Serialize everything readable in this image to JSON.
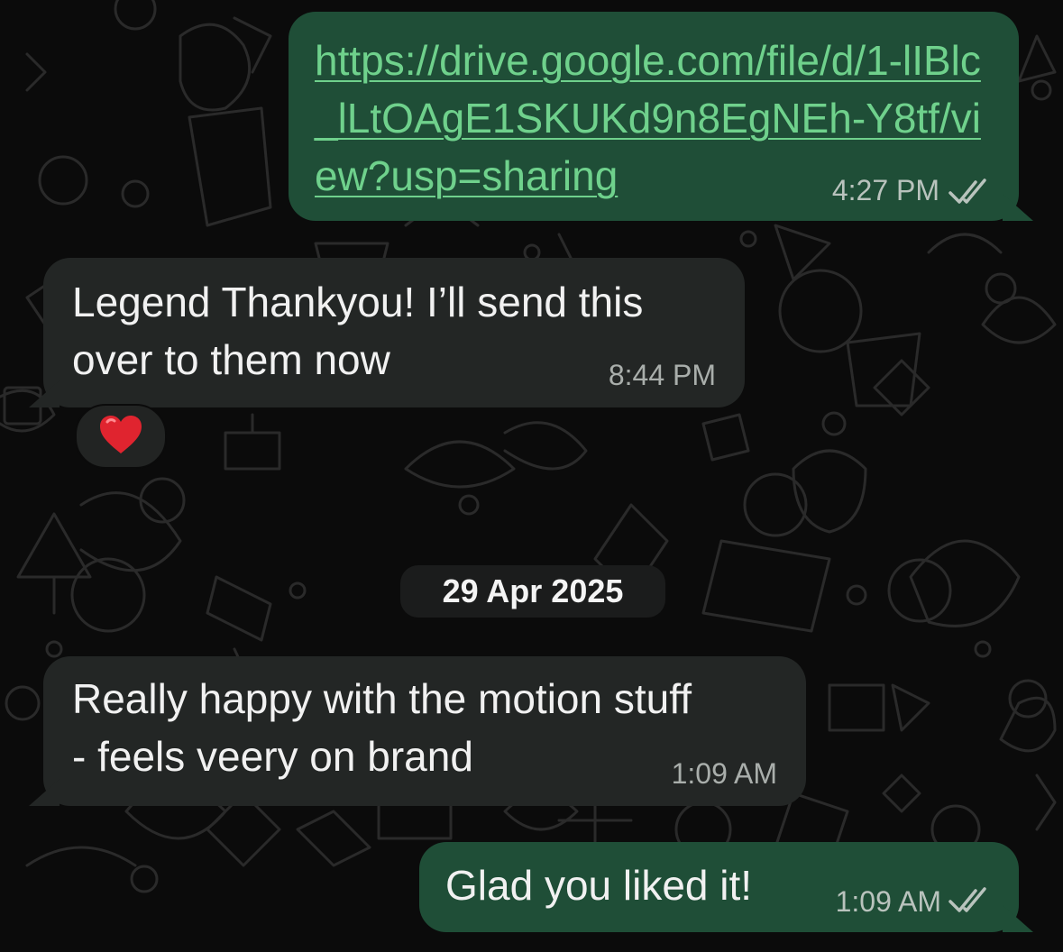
{
  "chat": {
    "date_divider": "29 Apr 2025",
    "messages": [
      {
        "direction": "outgoing",
        "text": "https://drive.google.com/file/d/1-lIBlc_lLtOAgE1SKUKd9n8EgNEh-Y8tf/view?usp=sharing",
        "time": "4:27 PM",
        "status": "read"
      },
      {
        "direction": "incoming",
        "text": "Legend Thankyou! I’ll send this\nover to them now",
        "time": "8:44 PM",
        "reaction": "❤️"
      },
      {
        "direction": "incoming",
        "text": "Really happy with the motion stuff\n- feels veery on brand",
        "time": "1:09 AM"
      },
      {
        "direction": "outgoing",
        "text": "Glad you liked it!",
        "time": "1:09 AM",
        "status": "read"
      }
    ]
  },
  "colors": {
    "background": "#0b0b0b",
    "outgoing_bubble": "#1f4e37",
    "incoming_bubble": "#232625",
    "link": "#6fd18c",
    "read_ticks": "#b9c3bd"
  },
  "icons": {
    "read_receipt": "double-check-icon",
    "reaction": "red-heart-icon"
  }
}
